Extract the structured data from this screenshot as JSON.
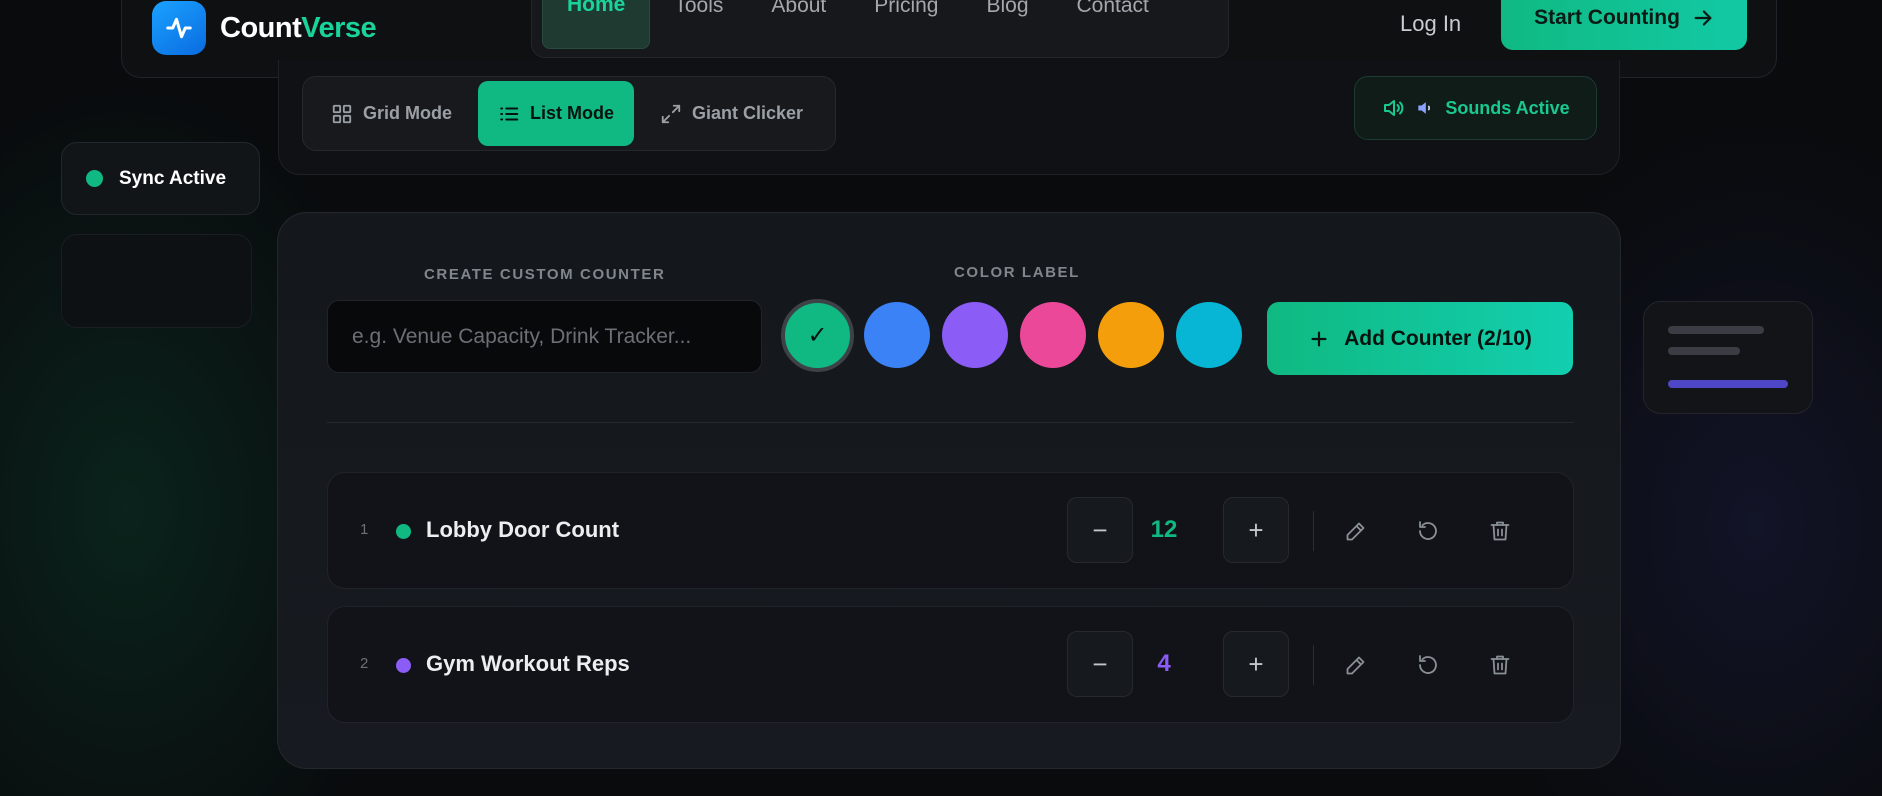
{
  "brand": {
    "name_part1": "Count",
    "name_part2": "Verse"
  },
  "nav": [
    {
      "label": "Home",
      "active": true
    },
    {
      "label": "Tools",
      "active": false
    },
    {
      "label": "About",
      "active": false
    },
    {
      "label": "Pricing",
      "active": false
    },
    {
      "label": "Blog",
      "active": false
    },
    {
      "label": "Contact",
      "active": false
    }
  ],
  "header": {
    "login_label": "Log In",
    "cta_label": "Start Counting"
  },
  "modes": [
    {
      "label": "Grid Mode",
      "icon": "grid-icon",
      "active": false
    },
    {
      "label": "List Mode",
      "icon": "list-icon",
      "active": true
    },
    {
      "label": "Giant Clicker",
      "icon": "expand-icon",
      "active": false
    }
  ],
  "sounds": {
    "label": "Sounds Active"
  },
  "sync": {
    "label": "Sync Active"
  },
  "create": {
    "label": "CREATE CUSTOM COUNTER",
    "placeholder": "e.g. Venue Capacity, Drink Tracker...",
    "color_label": "COLOR LABEL",
    "add_label": "Add Counter (2/10)",
    "selected_mark": "✓"
  },
  "colors": [
    "#10b981",
    "#3b82f6",
    "#8b5cf6",
    "#ec4899",
    "#f59e0b",
    "#06b6d4"
  ],
  "counters": [
    {
      "index": "1",
      "name": "Lobby Door Count",
      "value": "12",
      "color": "#10b981"
    },
    {
      "index": "2",
      "name": "Gym Workout Reps",
      "value": "4",
      "color": "#8b5cf6"
    }
  ],
  "step": {
    "minus": "−",
    "plus": "+"
  }
}
